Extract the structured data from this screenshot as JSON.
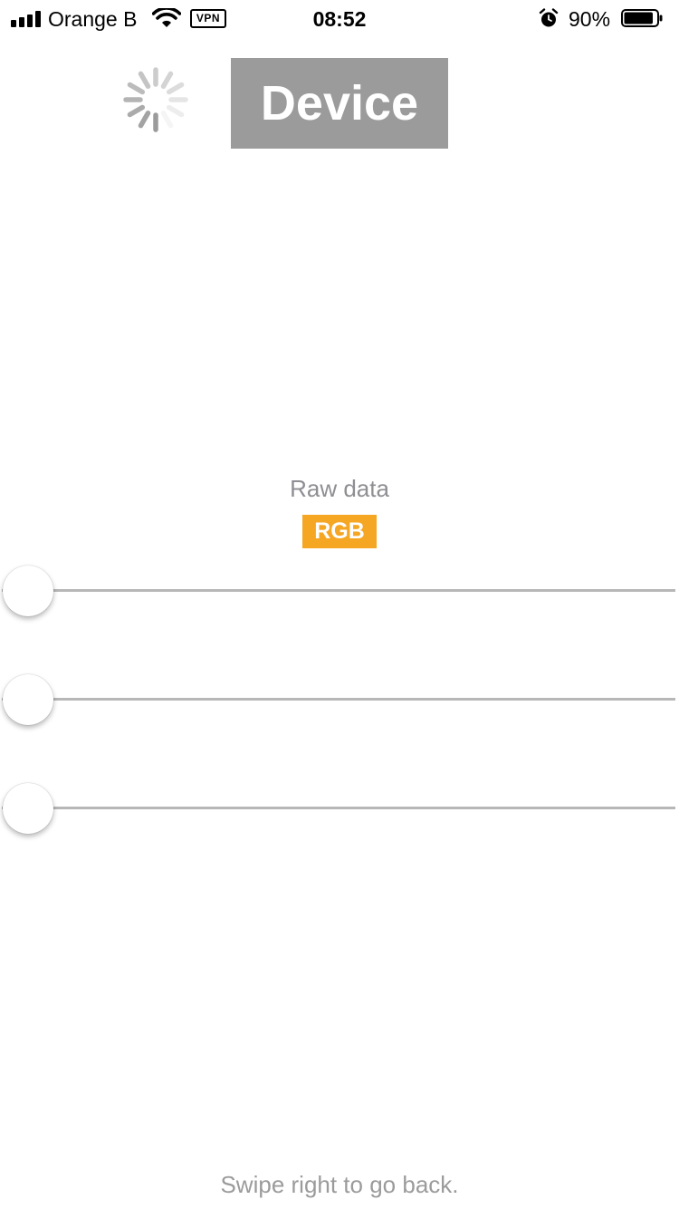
{
  "status_bar": {
    "carrier": "Orange B",
    "vpn_label": "VPN",
    "time": "08:52",
    "battery_percent": "90%",
    "battery_level": 0.9,
    "icons": [
      "signal-icon",
      "wifi-icon",
      "vpn-icon",
      "alarm-icon",
      "battery-icon"
    ]
  },
  "header": {
    "title": "Device",
    "spinner_icon": "activity-spinner-icon",
    "title_background": "#9b9b9b"
  },
  "data_section": {
    "label": "Raw data",
    "mode_badge": "RGB",
    "badge_color": "#f5a623",
    "sliders": [
      {
        "name": "slider-1",
        "value": 0
      },
      {
        "name": "slider-2",
        "value": 0
      },
      {
        "name": "slider-3",
        "value": 0
      }
    ]
  },
  "footer": {
    "hint": "Swipe right to go back."
  }
}
